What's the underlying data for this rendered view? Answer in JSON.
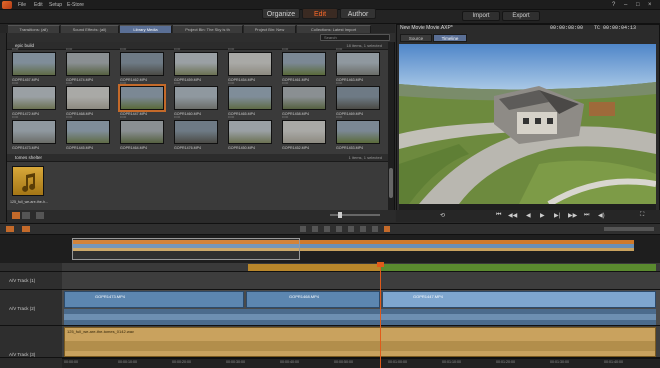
{
  "menu": {
    "items": [
      "File",
      "Edit",
      "Setup",
      "E-Store"
    ]
  },
  "modes": {
    "organize": "Organize",
    "edit": "Edit",
    "author": "Author",
    "active": "edit"
  },
  "top_buttons": {
    "import": "Import",
    "export": "Export"
  },
  "window_controls": [
    "?",
    "–",
    "□",
    "×"
  ],
  "library": {
    "tabs": [
      {
        "label": "Transitions: (all)",
        "active": false
      },
      {
        "label": "Sound Effects: (all)",
        "active": false
      },
      {
        "label": "Library Media",
        "active": true
      },
      {
        "label": "Project Bin: The Sky is th",
        "active": false
      },
      {
        "label": "Project Bin: New",
        "active": false
      },
      {
        "label": "Collections: Latest Import",
        "active": false
      }
    ],
    "search_placeholder": "Search",
    "section1": {
      "title": "epic build",
      "info": "18 items, 1 selected"
    },
    "section2": {
      "title": "tomes shelter",
      "info": "1 items, 1 selected"
    },
    "rows": [
      [
        "GOPR1457.MP4",
        "GOPR1474.MP4",
        "GOPR1462.MP4",
        "GOPR1459.MP4",
        "GOPR1454.MP4",
        "GOPR1461.MP4",
        "GOPR1463.MP4"
      ],
      [
        "GOPR1472.MP4",
        "GOPR1468.MP4",
        "GOPR1447.MP4",
        "GOPR1460.MP4",
        "GOPR1465.MP4",
        "GOPR1458.MP4",
        "GOPR1469.MP4"
      ],
      [
        "GOPR1473.MP4",
        "GOPR1445.MP4",
        "GOPR1464.MP4",
        "GOPR1476.MP4",
        "GOPR1450.MP4",
        "GOPR1452.MP4",
        "GOPR1453.MP4"
      ]
    ],
    "audio_item": "125_full_we-are-the-h..."
  },
  "preview": {
    "title": "New Movie Movie.AXP*",
    "timecode_left": "00:00:08:00",
    "timecode_right": "TC 00:00:04:13",
    "tabs": [
      "Source",
      "Timeline"
    ],
    "active_tab": "Timeline"
  },
  "timeline": {
    "tracks": [
      {
        "name": "",
        "type": "title"
      },
      {
        "name": "A/V Track (1)",
        "type": "video-empty"
      },
      {
        "name": "A/V Track (2)",
        "type": "video"
      },
      {
        "name": "A/V Track (3)",
        "type": "audio"
      }
    ],
    "video_clips": [
      "GOPR1473.MP4",
      "GOPR1468.MP4",
      "GOPR1447.MP4"
    ],
    "audio_clip": "125_full_we-are-the-tomes_0142.wav",
    "ruler": [
      "00:00:00",
      "00:00:10:00",
      "00:00:20:00",
      "00:00:30:00",
      "00:00:40:00",
      "00:00:50:00",
      "00:01:00:00",
      "00:01:10:00",
      "00:01:20:00",
      "00:01:30:00",
      "00:01:40:00"
    ]
  },
  "colors": {
    "accent": "#ff6a2a",
    "active_tab": "#5a6f95",
    "audio_clip": "#c9a25e",
    "video_clip": "#5c86b0",
    "title_track": "#b9872b"
  }
}
